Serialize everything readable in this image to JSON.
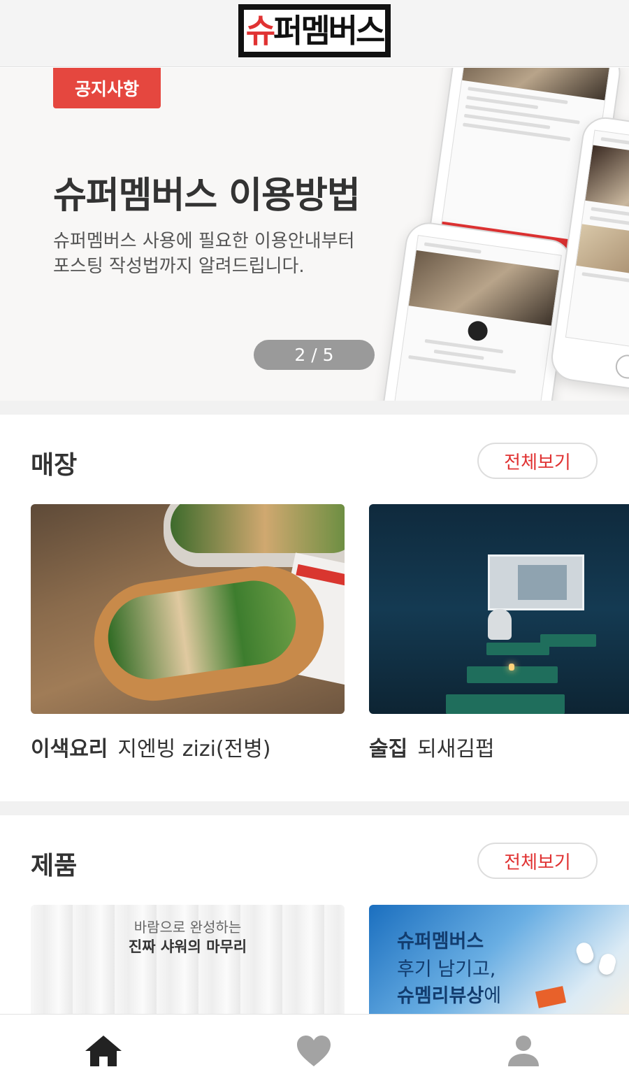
{
  "header": {
    "logo_text": "슈퍼멤버스",
    "logo_first": "슈",
    "logo_rest": "퍼멤버스"
  },
  "banner": {
    "badge": "공지사항",
    "title": "슈퍼멤버스 이용방법",
    "desc_line1": "슈퍼멤버스 사용에 필요한 이용안내부터",
    "desc_line2": "포스팅 작성법까지 알려드립니다.",
    "pager": "2 / 5",
    "current_page": 2,
    "total_pages": 5
  },
  "stores": {
    "title": "매장",
    "see_all": "전체보기",
    "items": [
      {
        "category": "이색요리",
        "name": "지엔빙 zizi(전병)"
      },
      {
        "category": "술집",
        "name": "되새김펍"
      }
    ]
  },
  "products": {
    "title": "제품",
    "see_all": "전체보기",
    "items": [
      {
        "line1": "바람으로 완성하는",
        "line2": "진짜 샤워의 마무리"
      },
      {
        "line1": "슈퍼멤버스",
        "line2": "후기 남기고,",
        "line3_bold": "슈멤리뷰상",
        "line3_rest": "에"
      }
    ]
  },
  "tabbar": {
    "items": [
      {
        "icon": "home-icon",
        "active": true
      },
      {
        "icon": "heart-icon",
        "active": false
      },
      {
        "icon": "user-icon",
        "active": false
      }
    ]
  },
  "colors": {
    "accent": "#e03232",
    "badge": "#e5473f",
    "tab_active": "#222222",
    "tab_inactive": "#a3a3a3"
  }
}
